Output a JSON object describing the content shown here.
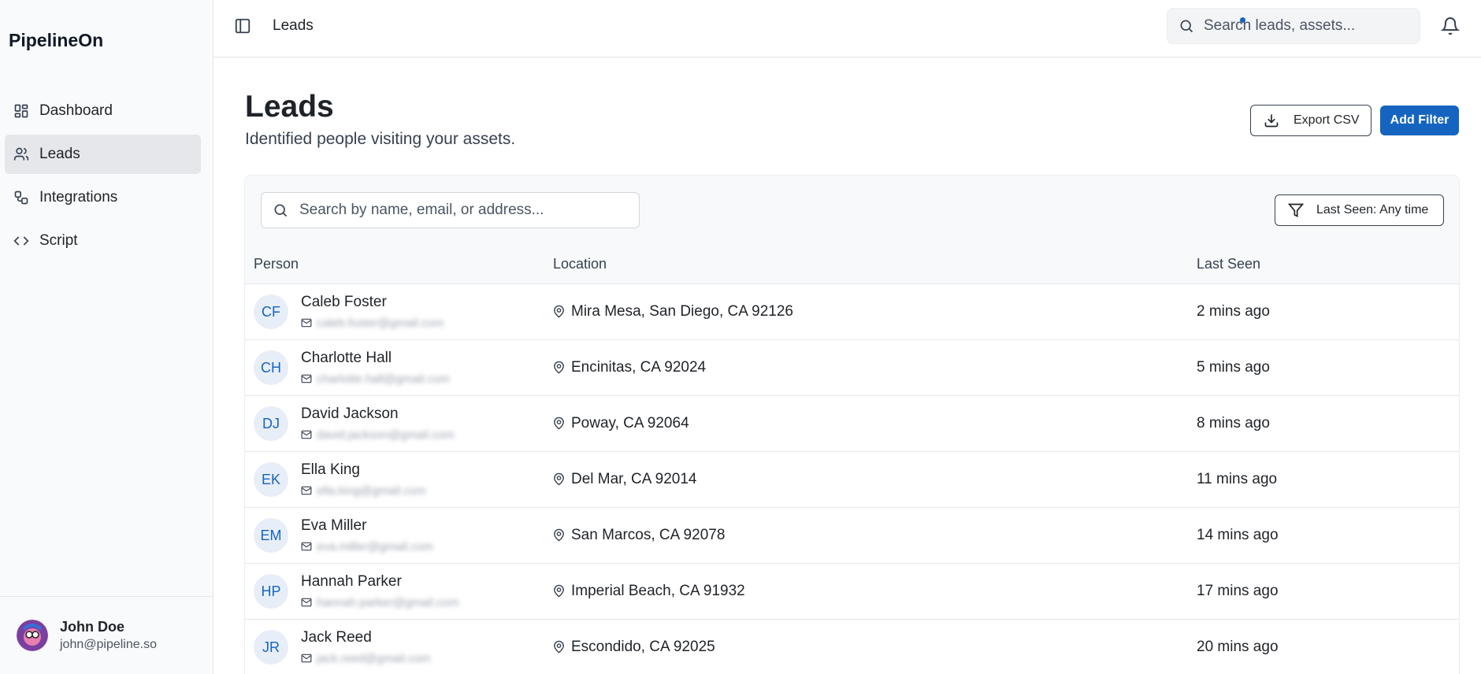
{
  "app": {
    "brand": "PipelineOn"
  },
  "sidebar": {
    "items": [
      {
        "label": "Dashboard",
        "icon": "dashboard-icon"
      },
      {
        "label": "Leads",
        "icon": "users-icon",
        "active": true
      },
      {
        "label": "Integrations",
        "icon": "integrations-icon"
      },
      {
        "label": "Script",
        "icon": "code-icon"
      }
    ]
  },
  "user": {
    "name": "John Doe",
    "email": "john@pipeline.so"
  },
  "topbar": {
    "breadcrumb": "Leads",
    "search_placeholder": "Search leads, assets..."
  },
  "page": {
    "title": "Leads",
    "subtitle": "Identified people visiting your assets."
  },
  "actions": {
    "export_label": "Export CSV",
    "add_filter_label": "Add Filter"
  },
  "table": {
    "search_placeholder": "Search by name, email, or address...",
    "filter_label": "Last Seen: Any time",
    "columns": [
      "Person",
      "Location",
      "Last Seen"
    ],
    "rows": [
      {
        "initials": "CF",
        "name": "Caleb Foster",
        "email": "caleb.foster@gmail.com",
        "location": "Mira Mesa, San Diego, CA 92126",
        "last_seen": "2 mins ago"
      },
      {
        "initials": "CH",
        "name": "Charlotte Hall",
        "email": "charlotte.hall@gmail.com",
        "location": "Encinitas, CA 92024",
        "last_seen": "5 mins ago"
      },
      {
        "initials": "DJ",
        "name": "David Jackson",
        "email": "david.jackson@gmail.com",
        "location": "Poway, CA 92064",
        "last_seen": "8 mins ago"
      },
      {
        "initials": "EK",
        "name": "Ella King",
        "email": "ella.king@gmail.com",
        "location": "Del Mar, CA 92014",
        "last_seen": "11 mins ago"
      },
      {
        "initials": "EM",
        "name": "Eva Miller",
        "email": "eva.miller@gmail.com",
        "location": "San Marcos, CA 92078",
        "last_seen": "14 mins ago"
      },
      {
        "initials": "HP",
        "name": "Hannah Parker",
        "email": "hannah.parker@gmail.com",
        "location": "Imperial Beach, CA 91932",
        "last_seen": "17 mins ago"
      },
      {
        "initials": "JR",
        "name": "Jack Reed",
        "email": "jack.reed@gmail.com",
        "location": "Escondido, CA 92025",
        "last_seen": "20 mins ago"
      }
    ]
  },
  "colors": {
    "accent": "#1565c0",
    "sidebar_bg": "#f9fafb",
    "active_nav": "#e5e7eb",
    "avatar_bg": "#e8eef8"
  }
}
